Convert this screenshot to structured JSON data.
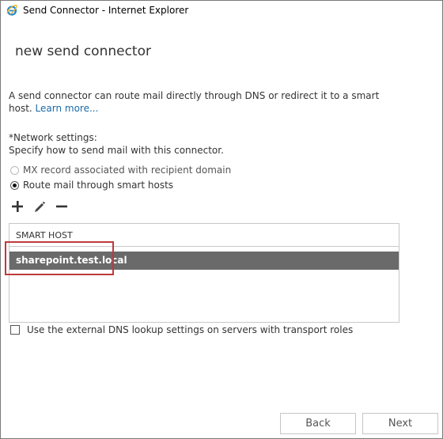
{
  "window": {
    "title": "Send Connector - Internet Explorer",
    "icon": "internet-explorer-icon"
  },
  "page": {
    "title": "new send connector",
    "description": "A send connector can route mail directly through DNS or redirect it to a smart host.",
    "learn_more": "Learn more..."
  },
  "network": {
    "heading": "*Network settings:",
    "subheading": "Specify how to send mail with this connector.",
    "options": [
      {
        "label": "MX record associated with recipient domain",
        "selected": false,
        "enabled": false
      },
      {
        "label": "Route mail through smart hosts",
        "selected": true,
        "enabled": true
      }
    ]
  },
  "toolbar": {
    "add_icon": "plus-icon",
    "edit_icon": "pencil-icon",
    "remove_icon": "minus-icon"
  },
  "smart_hosts": {
    "column": "SMART HOST",
    "rows": [
      "sharepoint.test.local"
    ]
  },
  "external_dns": {
    "label": "Use the external DNS lookup settings on servers with transport roles",
    "checked": false
  },
  "buttons": {
    "back": "Back",
    "next": "Next"
  },
  "colors": {
    "accent_link": "#1a6aa8",
    "selected_row": "#6a6a6a",
    "highlight_box": "#c0393b"
  }
}
